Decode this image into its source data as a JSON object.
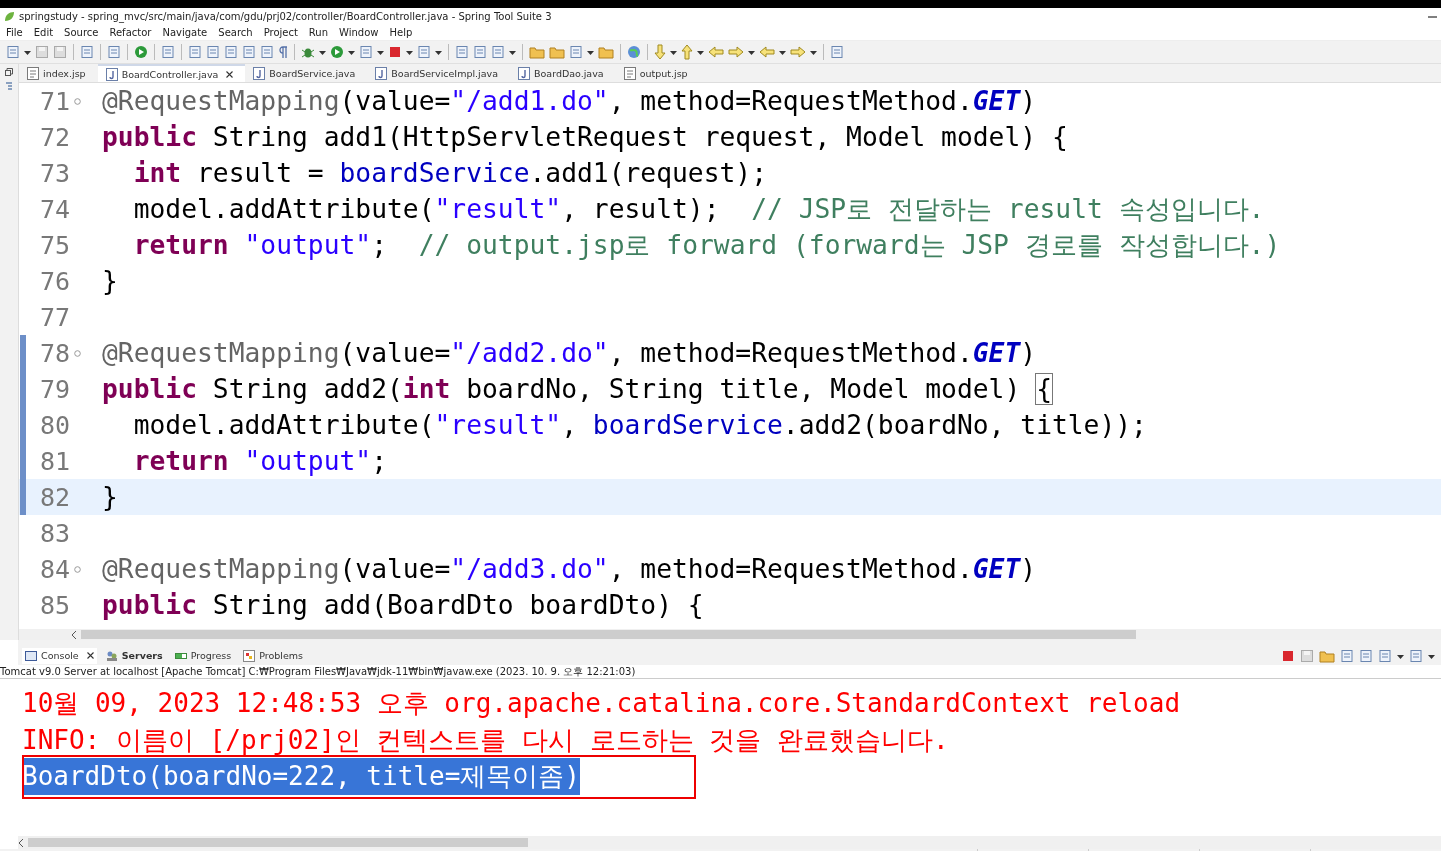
{
  "window": {
    "title": "springstudy - spring_mvc/src/main/java/com/gdu/prj02/controller/BoardController.java - Spring Tool Suite 3"
  },
  "menu": [
    "File",
    "Edit",
    "Source",
    "Refactor",
    "Navigate",
    "Search",
    "Project",
    "Run",
    "Window",
    "Help"
  ],
  "editor_tabs": [
    {
      "label": "index.jsp",
      "kind": "jsp",
      "selected": false
    },
    {
      "label": "BoardController.java",
      "kind": "java",
      "selected": true
    },
    {
      "label": "BoardService.java",
      "kind": "java",
      "selected": false
    },
    {
      "label": "BoardServiceImpl.java",
      "kind": "java",
      "selected": false
    },
    {
      "label": "BoardDao.java",
      "kind": "java",
      "selected": false
    },
    {
      "label": "output.jsp",
      "kind": "jsp",
      "selected": false
    }
  ],
  "editor": {
    "lines": [
      {
        "number": "71",
        "foldable": true,
        "changed": false,
        "current": false,
        "indented": false,
        "tokens": [
          {
            "kind": "ann",
            "text": "@RequestMapping"
          },
          {
            "kind": "plain",
            "text": "(value="
          },
          {
            "kind": "str",
            "text": "\"/add1.do\""
          },
          {
            "kind": "plain",
            "text": ", method=RequestMethod."
          },
          {
            "kind": "static",
            "text": "GET"
          },
          {
            "kind": "plain",
            "text": ")"
          }
        ]
      },
      {
        "number": "72",
        "foldable": false,
        "changed": false,
        "current": false,
        "indented": false,
        "tokens": [
          {
            "kind": "kw",
            "text": "public"
          },
          {
            "kind": "plain",
            "text": " String add1(HttpServletRequest request, Model model) {"
          }
        ]
      },
      {
        "number": "73",
        "foldable": false,
        "changed": false,
        "current": false,
        "indented": true,
        "tokens": [
          {
            "kind": "kw",
            "text": "int"
          },
          {
            "kind": "plain",
            "text": " result = "
          },
          {
            "kind": "field",
            "text": "boardService"
          },
          {
            "kind": "plain",
            "text": ".add1(request);"
          }
        ]
      },
      {
        "number": "74",
        "foldable": false,
        "changed": false,
        "current": false,
        "indented": true,
        "tokens": [
          {
            "kind": "plain",
            "text": "model.addAttribute("
          },
          {
            "kind": "str",
            "text": "\"result\""
          },
          {
            "kind": "plain",
            "text": ", result);  "
          },
          {
            "kind": "comment",
            "text": "// JSP로 전달하는 result 속성입니다."
          }
        ]
      },
      {
        "number": "75",
        "foldable": false,
        "changed": false,
        "current": false,
        "indented": true,
        "tokens": [
          {
            "kind": "kw",
            "text": "return"
          },
          {
            "kind": "str",
            "text": " \"output\""
          },
          {
            "kind": "plain",
            "text": ";  "
          },
          {
            "kind": "comment",
            "text": "// output.jsp로 forward (forward는 JSP 경로를 작성합니다.)"
          }
        ]
      },
      {
        "number": "76",
        "foldable": false,
        "changed": false,
        "current": false,
        "indented": false,
        "tokens": [
          {
            "kind": "plain",
            "text": "}"
          }
        ]
      },
      {
        "number": "77",
        "foldable": false,
        "changed": false,
        "current": false
      },
      {
        "number": "78",
        "foldable": true,
        "changed": true,
        "current": false,
        "indented": false,
        "tokens": [
          {
            "kind": "ann",
            "text": "@RequestMapping"
          },
          {
            "kind": "plain",
            "text": "(value="
          },
          {
            "kind": "str",
            "text": "\"/add2.do\""
          },
          {
            "kind": "plain",
            "text": ", method=RequestMethod."
          },
          {
            "kind": "static",
            "text": "GET"
          },
          {
            "kind": "plain",
            "text": ")"
          }
        ]
      },
      {
        "number": "79",
        "foldable": false,
        "changed": true,
        "current": false,
        "indented": false,
        "tokens": [
          {
            "kind": "kw",
            "text": "public"
          },
          {
            "kind": "plain",
            "text": " String add2("
          },
          {
            "kind": "kw",
            "text": "int"
          },
          {
            "kind": "plain",
            "text": " boardNo, String title, Model model) "
          },
          {
            "kind": "bracket",
            "text": "{"
          }
        ]
      },
      {
        "number": "80",
        "foldable": false,
        "changed": true,
        "current": false,
        "indented": true,
        "tokens": [
          {
            "kind": "plain",
            "text": "model.addAttribute("
          },
          {
            "kind": "str",
            "text": "\"result\""
          },
          {
            "kind": "plain",
            "text": ", "
          },
          {
            "kind": "field",
            "text": "boardService"
          },
          {
            "kind": "plain",
            "text": ".add2(boardNo, title));"
          }
        ]
      },
      {
        "number": "81",
        "foldable": false,
        "changed": true,
        "current": false,
        "indented": true,
        "tokens": [
          {
            "kind": "kw",
            "text": "return"
          },
          {
            "kind": "str",
            "text": " \"output\""
          },
          {
            "kind": "plain",
            "text": ";"
          }
        ]
      },
      {
        "number": "82",
        "foldable": false,
        "changed": true,
        "current": true,
        "indented": false,
        "tokens": [
          {
            "kind": "plain",
            "text": "}"
          }
        ]
      },
      {
        "number": "83",
        "foldable": false,
        "changed": false,
        "current": false
      },
      {
        "number": "84",
        "foldable": true,
        "changed": false,
        "current": false,
        "indented": false,
        "tokens": [
          {
            "kind": "ann",
            "text": "@RequestMapping"
          },
          {
            "kind": "plain",
            "text": "(value="
          },
          {
            "kind": "str",
            "text": "\"/add3.do\""
          },
          {
            "kind": "plain",
            "text": ", method=RequestMethod."
          },
          {
            "kind": "static",
            "text": "GET"
          },
          {
            "kind": "plain",
            "text": ")"
          }
        ]
      },
      {
        "number": "85",
        "foldable": false,
        "changed": false,
        "current": false,
        "indented": false,
        "tokens": [
          {
            "kind": "kw",
            "text": "public"
          },
          {
            "kind": "plain",
            "text": " String add(BoardDto boardDto) {"
          }
        ]
      }
    ]
  },
  "console_tabs": [
    {
      "label": "Console",
      "kind": "console",
      "selected": true,
      "bold": false
    },
    {
      "label": "Servers",
      "kind": "servers",
      "selected": false,
      "bold": true
    },
    {
      "label": "Progress",
      "kind": "progress",
      "selected": false,
      "bold": false
    },
    {
      "label": "Problems",
      "kind": "problems",
      "selected": false,
      "bold": false
    }
  ],
  "console": {
    "process": "Tomcat v9.0 Server at localhost [Apache Tomcat] C:₩Program Files₩Java₩jdk-11₩bin₩javaw.exe  (2023. 10. 9. 오후 12:21:03)",
    "lines": [
      {
        "text": "10월 09, 2023 12:48:53 오후 org.apache.catalina.core.StandardContext reload",
        "kind": "stderr",
        "selected": false,
        "boxed": false
      },
      {
        "text": "INFO: 이름이 [/prj02]인 컨텍스트를 다시 로드하는 것을 완료했습니다.",
        "kind": "stderr",
        "selected": false,
        "boxed": false
      },
      {
        "text": "BoardDto(boardNo=222, title=제목이좀)",
        "kind": "stdout",
        "selected": true,
        "boxed": true
      }
    ]
  }
}
